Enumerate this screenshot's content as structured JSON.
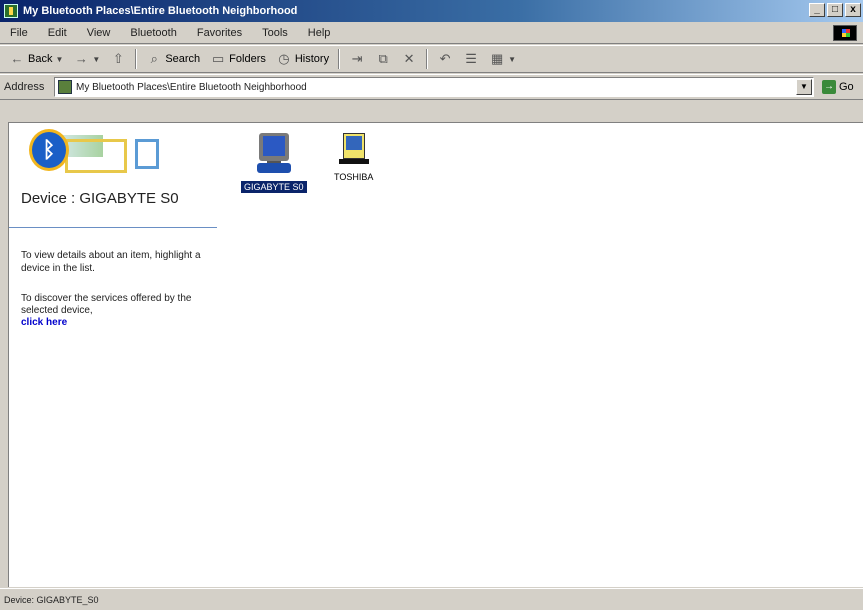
{
  "window": {
    "title": "My Bluetooth Places\\Entire Bluetooth Neighborhood",
    "btn_minimize": "_",
    "btn_maximize": "□",
    "btn_close": "x"
  },
  "menu": {
    "items": [
      "File",
      "Edit",
      "View",
      "Bluetooth",
      "Favorites",
      "Tools",
      "Help"
    ]
  },
  "toolbar": {
    "back": "Back",
    "search": "Search",
    "folders": "Folders",
    "history": "History"
  },
  "address": {
    "label": "Address",
    "value": "My Bluetooth Places\\Entire Bluetooth Neighborhood",
    "go": "Go"
  },
  "sidebar": {
    "device_title": "Device : GIGABYTE S0",
    "hint1": "To view details about an item, highlight a device in the list.",
    "hint2": "To discover the services offered by the selected device,",
    "click_link": "click here"
  },
  "devices": [
    {
      "label": "GIGABYTE S0",
      "icon": "computer-icon",
      "selected": true
    },
    {
      "label": "TOSHIBA",
      "icon": "pda-icon",
      "selected": false
    }
  ],
  "status": {
    "text": "Device: GIGABYTE_S0"
  }
}
